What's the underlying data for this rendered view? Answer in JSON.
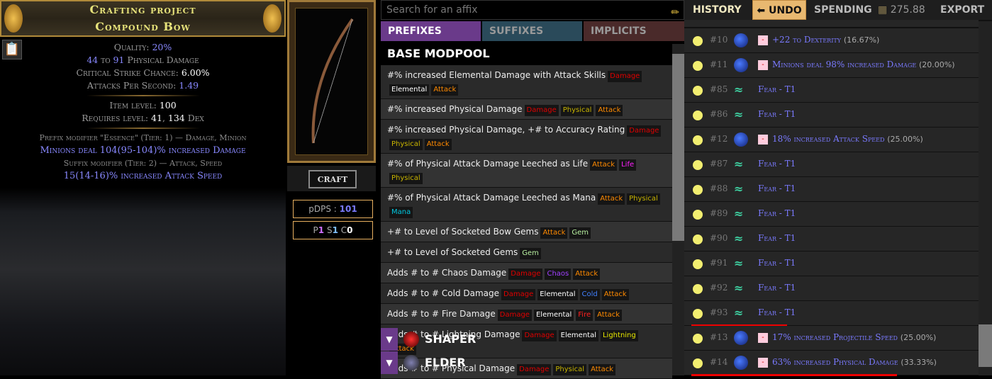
{
  "item": {
    "title": "Crafting project",
    "name": "Compound Bow",
    "quality_label": "Quality: ",
    "quality": "20%",
    "phys_min": "44",
    "phys_to": " to ",
    "phys_max": "91",
    "phys_label": " Physical Damage",
    "crit_label": "Critical Strike Chance: ",
    "crit": "6.00%",
    "aps_label": "Attacks Per Second: ",
    "aps": "1.49",
    "ilvl_label": "Item level: ",
    "ilvl": "100",
    "req_label": "Requires level: ",
    "req_level": "41",
    "req_sep": ", ",
    "req_dex": "134",
    "req_dex_label": " Dex",
    "prefix_header": "Prefix modifier \"Essence\" (Tier: 1) — Damage, Minion",
    "prefix_value": "Minions deal 104(95-104)% increased Damage",
    "suffix_header": "Suffix modifier (Tier: 2) — Attack, Speed",
    "suffix_value": "15(14-16)% increased Attack Speed"
  },
  "craft_label": "CRAFT",
  "pdps": {
    "label": "pDPS : ",
    "value": "101"
  },
  "psc": {
    "p": "P",
    "pv": "1",
    "s": "S",
    "sv": "1",
    "c": "C",
    "cv": "0"
  },
  "search": {
    "placeholder": "Search for an affix"
  },
  "tabs": [
    {
      "label": "PREFIXES",
      "color": "#6a3a8a"
    },
    {
      "label": "SUFFIXES",
      "color": "#2a4a5a"
    },
    {
      "label": "IMPLICITS",
      "color": "#4a2a2a"
    }
  ],
  "modpool_title": "BASE MODPOOL",
  "tag_colors": {
    "Damage": "#e00000",
    "Elemental": "#ffffff",
    "Attack": "#ff8a00",
    "Physical": "#c8b400",
    "Life": "#ff20ff",
    "Mana": "#00c8e0",
    "Gem": "#b8f0a0",
    "Chaos": "#a040ff",
    "Cold": "#4080ff",
    "Fire": "#ff2020",
    "Lightning": "#e8e800"
  },
  "mods": [
    {
      "text": "#% increased Elemental Damage with Attack Skills",
      "tags": [
        "Damage",
        "Elemental",
        "Attack"
      ]
    },
    {
      "text": "#% increased Physical Damage",
      "tags": [
        "Damage",
        "Physical",
        "Attack"
      ]
    },
    {
      "text": "#% increased Physical Damage, +# to Accuracy Rating",
      "tags": [
        "Damage",
        "Physical",
        "Attack"
      ]
    },
    {
      "text": "#% of Physical Attack Damage Leeched as Life",
      "tags": [
        "Attack",
        "Life",
        "Physical"
      ]
    },
    {
      "text": "#% of Physical Attack Damage Leeched as Mana",
      "tags": [
        "Attack",
        "Physical",
        "Mana"
      ]
    },
    {
      "text": "+# to Level of Socketed Bow Gems",
      "tags": [
        "Attack",
        "Gem"
      ]
    },
    {
      "text": "+# to Level of Socketed Gems",
      "tags": [
        "Gem"
      ]
    },
    {
      "text": "Adds # to # Chaos Damage",
      "tags": [
        "Damage",
        "Chaos",
        "Attack"
      ]
    },
    {
      "text": "Adds # to # Cold Damage",
      "tags": [
        "Damage",
        "Elemental",
        "Cold",
        "Attack"
      ]
    },
    {
      "text": "Adds # to # Fire Damage",
      "tags": [
        "Damage",
        "Elemental",
        "Fire",
        "Attack"
      ]
    },
    {
      "text": "Adds # to # Lightning Damage",
      "tags": [
        "Damage",
        "Elemental",
        "Lightning",
        "Attack"
      ]
    },
    {
      "text": "Adds # to # Physical Damage",
      "tags": [
        "Damage",
        "Physical",
        "Attack"
      ]
    }
  ],
  "groups": [
    {
      "label": "SHAPER"
    },
    {
      "label": "ELDER"
    }
  ],
  "history_header": {
    "history": "HISTORY",
    "undo": "UNDO",
    "spending": "SPENDING",
    "amount": "275.88",
    "export": "EXPORT"
  },
  "history": [
    {
      "num": "#10",
      "icon": "orb",
      "minus": true,
      "text": "+22 to Dexterity",
      "pct": "(16.67%)"
    },
    {
      "num": "#11",
      "icon": "orb",
      "minus": true,
      "text": "Minions deal 98% increased Damage",
      "pct": "(20.00%)"
    },
    {
      "num": "#85",
      "icon": "fear",
      "text": "Fear - T1"
    },
    {
      "num": "#86",
      "icon": "fear",
      "text": "Fear - T1"
    },
    {
      "num": "#12",
      "icon": "orb",
      "minus": true,
      "text": "18% increased Attack Speed",
      "pct": "(25.00%)"
    },
    {
      "num": "#87",
      "icon": "fear",
      "text": "Fear - T1"
    },
    {
      "num": "#88",
      "icon": "fear",
      "text": "Fear - T1"
    },
    {
      "num": "#89",
      "icon": "fear",
      "text": "Fear - T1"
    },
    {
      "num": "#90",
      "icon": "fear",
      "text": "Fear - T1"
    },
    {
      "num": "#91",
      "icon": "fear",
      "text": "Fear - T1"
    },
    {
      "num": "#92",
      "icon": "fear",
      "text": "Fear - T1"
    },
    {
      "num": "#93",
      "icon": "fear",
      "text": "Fear - T1",
      "underline": true
    },
    {
      "num": "#13",
      "icon": "orb",
      "minus": true,
      "text": "17% increased Projectile Speed",
      "pct": "(25.00%)"
    },
    {
      "num": "#14",
      "icon": "orb",
      "minus": true,
      "text": "63% increased Physical Damage",
      "pct": "(33.33%)",
      "underline": true
    }
  ]
}
